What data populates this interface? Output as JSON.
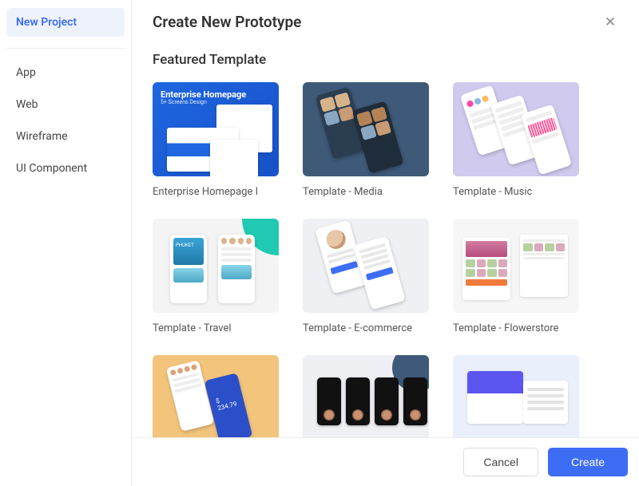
{
  "sidebar": {
    "header": "New Project",
    "items": [
      {
        "label": "App"
      },
      {
        "label": "Web"
      },
      {
        "label": "Wireframe"
      },
      {
        "label": "UI Component"
      }
    ]
  },
  "header": {
    "title": "Create New Prototype"
  },
  "section": {
    "title": "Featured Template"
  },
  "templates": [
    {
      "label": "Enterprise Homepage I",
      "thumb_title": "Enterprise Homepage",
      "thumb_subtitle": "5+ Screens Design"
    },
    {
      "label": "Template - Media"
    },
    {
      "label": "Template - Music"
    },
    {
      "label": "Template - Travel",
      "hero_text": "PHUKET"
    },
    {
      "label": "Template - E-commerce"
    },
    {
      "label": "Template - Flowerstore"
    },
    {
      "label": "",
      "amount": "$ 234.79"
    },
    {
      "label": ""
    },
    {
      "label": ""
    }
  ],
  "footer": {
    "cancel": "Cancel",
    "create": "Create"
  }
}
